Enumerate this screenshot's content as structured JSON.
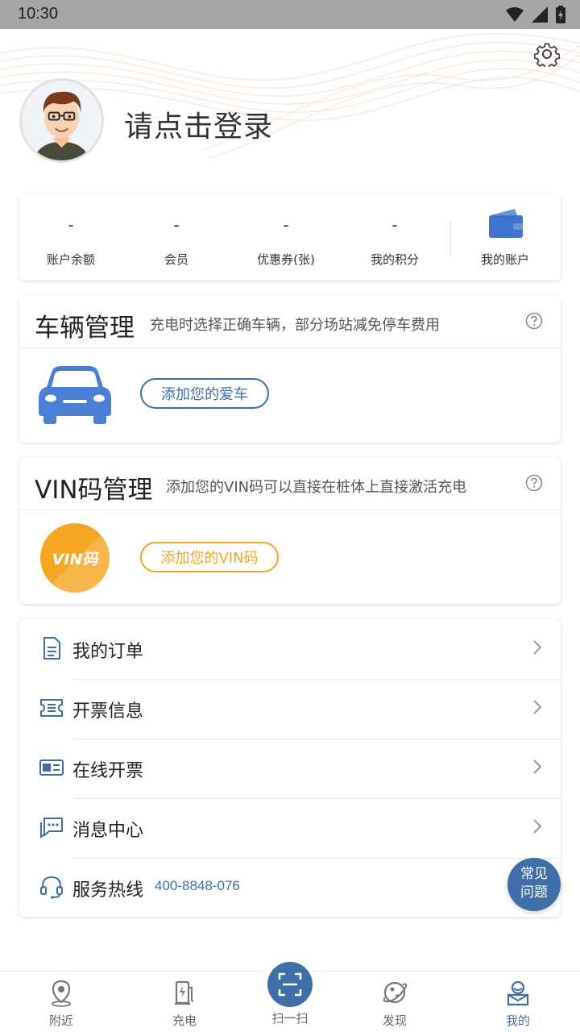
{
  "status_bar": {
    "time": "10:30"
  },
  "profile": {
    "login_prompt": "请点击登录"
  },
  "stats": [
    {
      "value": "-",
      "label": "账户余额"
    },
    {
      "value": "-",
      "label": "会员"
    },
    {
      "value": "-",
      "label": "优惠券(张)"
    },
    {
      "value": "-",
      "label": "我的积分"
    }
  ],
  "wallet": {
    "label": "我的账户"
  },
  "vehicle": {
    "title": "车辆管理",
    "description": "充电时选择正确车辆，部分场站减免停车费用",
    "button": "添加您的爱车"
  },
  "vin": {
    "title": "VIN码管理",
    "description": "添加您的VIN码可以直接在桩体上直接激活充电",
    "badge": "VIN码",
    "button": "添加您的VIN码"
  },
  "menu": [
    {
      "label": "我的订单"
    },
    {
      "label": "开票信息"
    },
    {
      "label": "在线开票"
    },
    {
      "label": "消息中心"
    }
  ],
  "hotline": {
    "label": "服务热线",
    "number": "400-8848-076"
  },
  "faq": {
    "line1": "常见",
    "line2": "问题"
  },
  "tabs": [
    {
      "label": "附近"
    },
    {
      "label": "充电"
    },
    {
      "label": "扫一扫"
    },
    {
      "label": "发现"
    },
    {
      "label": "我的"
    }
  ],
  "colors": {
    "primary": "#3f6fa6",
    "accent_orange": "#f0a623",
    "car_blue": "#4a7fd4"
  }
}
